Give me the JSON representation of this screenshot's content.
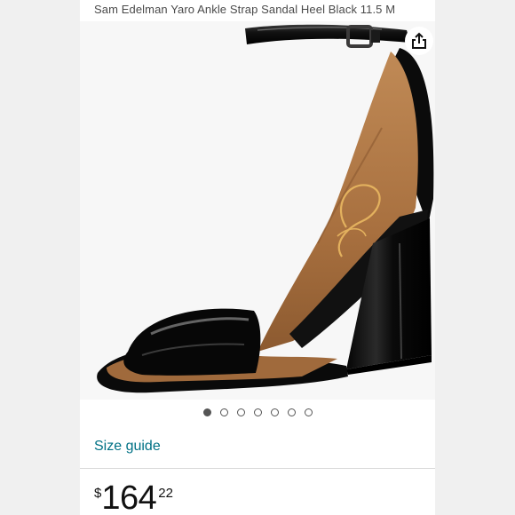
{
  "product": {
    "title": "Sam Edelman Yaro Ankle Strap Sandal Heel Black 11.5 M",
    "image_alt": "Black patent ankle strap block heel sandal",
    "share_icon": "share-icon"
  },
  "carousel": {
    "count": 7,
    "active_index": 0
  },
  "links": {
    "size_guide": "Size guide"
  },
  "price": {
    "currency": "$",
    "whole": "164",
    "fraction": "22"
  },
  "colors": {
    "link": "#007185",
    "shoe_black": "#0c0c0c",
    "insole_tan": "#b07a4c"
  }
}
